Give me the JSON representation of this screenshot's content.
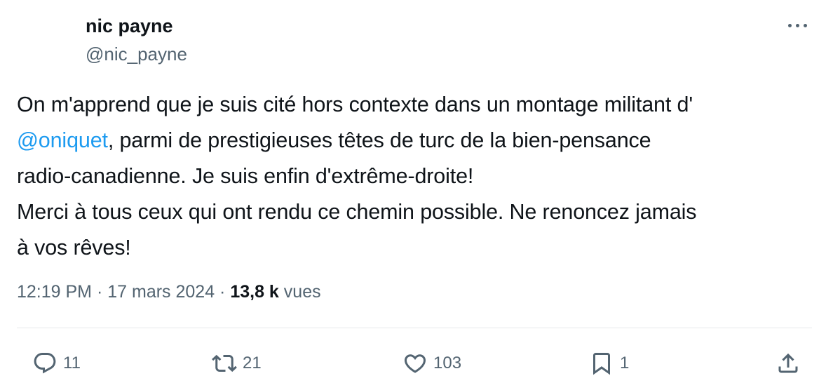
{
  "author": {
    "name": "nic payne",
    "handle": "@nic_payne"
  },
  "tweet": {
    "line1": "On m'apprend que je suis cité hors contexte dans un montage militant d'",
    "mention": "@oniquet",
    "line2_rest": ", parmi de prestigieuses têtes de turc de la bien-pensance",
    "line3": "radio-canadienne. Je suis enfin d'extrême-droite!",
    "line4": "Merci à tous ceux qui ont rendu ce chemin possible. Ne renoncez jamais",
    "line5": "à vos rêves!"
  },
  "meta": {
    "time": "12:19 PM",
    "sep1": " · ",
    "date": "17 mars 2024",
    "sep2": " · ",
    "views_count": "13,8 k",
    "views_label": " vues"
  },
  "actions": {
    "replies": "11",
    "reposts": "21",
    "likes": "103",
    "bookmarks": "1"
  },
  "icons": {
    "more": "more-icon",
    "reply": "reply-icon",
    "repost": "repost-icon",
    "like": "heart-icon",
    "bookmark": "bookmark-icon",
    "share": "share-icon"
  },
  "colors": {
    "text": "#0f1419",
    "secondary": "#536471",
    "link": "#1d9bf0",
    "divider": "#e7e9ea"
  }
}
